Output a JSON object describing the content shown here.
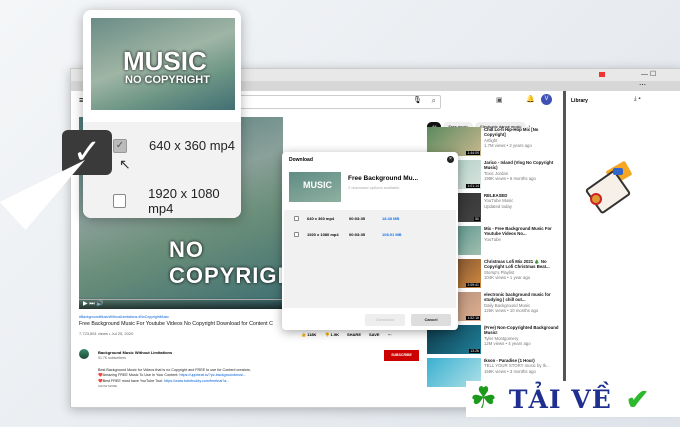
{
  "browser": {
    "menu_icon": "hamburger-icon"
  },
  "youtube": {
    "video": {
      "overlay_title": "NO COPYRIGHT",
      "hashtags": "#BackgroundMusicWithoutLimitations #NoCopyrightMusic",
      "title": "Free Background Music For Youtube Videos No Copyright Download for Content C",
      "meta": "7,723,851 views • Jul 25, 2020",
      "likes": "118K",
      "dislikes": "1.9K",
      "share": "SHARE",
      "save": "SAVE"
    },
    "channel": {
      "name": "Background Music Without Limitations",
      "subs": "91.7K subscribers",
      "subscribe": "SUBSCRIBE",
      "desc1": "Best Background Music for Videos that is no Copyright and FREE to use for Content creators.",
      "desc2": "❤️Amazing FREE Music To Use In Your Content: ",
      "link2": "https://uppbeat.io/?pc-backgroundmusi...",
      "desc3": "❤️Best FREE must have YouTube Tool: ",
      "link3": "https://www.tubebuddy.com/freetrial?a...",
      "show_more": "SHOW MORE"
    },
    "chips": [
      "All",
      "Free music",
      "Electronic dance music"
    ],
    "related": [
      {
        "title": "Chill Lo-fi Hip-Hop Mix [No Copyright]",
        "channel": "Artlight",
        "meta": "1.7M views • 2 years ago",
        "duration": "1:44:09"
      },
      {
        "title": "Jarico - Island (Vlog No Copyright Music)",
        "channel": "Toxic Jordan",
        "meta": "198K views • 6 months ago",
        "duration": "1:01:14"
      },
      {
        "title": "RELEASED",
        "channel": "YouTube Music",
        "meta": "Updated today",
        "duration": "50"
      },
      {
        "title": "Mix - Free Background Music For Youtube Videos No...",
        "channel": "YouTube",
        "meta": "",
        "duration": ""
      },
      {
        "title": "Christmas Lofi Mix 2021 🎄 No Copyright Lofi Christmas Beat...",
        "channel": "Stomp's Playlist",
        "meta": "104K views • 1 year ago",
        "duration": "2:09:41"
      },
      {
        "title": "electronic background music for studying | chill out...",
        "channel": "Daily Background Music",
        "meta": "126K views • 10 months ago",
        "duration": "1:52:16"
      },
      {
        "title": "(Free) Non-Copyrighted Background Music!",
        "channel": "Tyler Montgomery",
        "meta": "12M views • 4 years ago",
        "duration": "13:26"
      },
      {
        "title": "Ikson - Paradise (1 Hour)",
        "channel": "TELL YOUR STORY music by Ik...",
        "meta": "159K views • 3 months ago",
        "duration": ""
      }
    ]
  },
  "library": {
    "title": "Library"
  },
  "dialog": {
    "title": "Download",
    "video_title": "Free Background Mu...",
    "subtitle": "2 download options available",
    "thumb_text": "MUSIC",
    "options": [
      {
        "quality": "640 x 360 mp4",
        "duration": "00:03:35",
        "size": "18.38 MB"
      },
      {
        "quality": "1920 x 1080 mp4",
        "duration": "00:03:35",
        "size": "108.91 MB"
      }
    ],
    "download": "Download",
    "cancel": "Cancel"
  },
  "popup": {
    "thumb_title": "MUSIC",
    "thumb_sub": "NO COPYRIGHT",
    "options": [
      {
        "label": "640 x 360 mp4",
        "checked": true
      },
      {
        "label": "1920 x 1080 mp4",
        "checked": false
      }
    ]
  },
  "logo": {
    "text": "TẢI VỀ"
  },
  "colors": {
    "accent_blue": "#1a73e8",
    "subscribe_red": "#cc0000",
    "logo_blue": "#1f2f8f",
    "check_green": "#2db82d"
  }
}
